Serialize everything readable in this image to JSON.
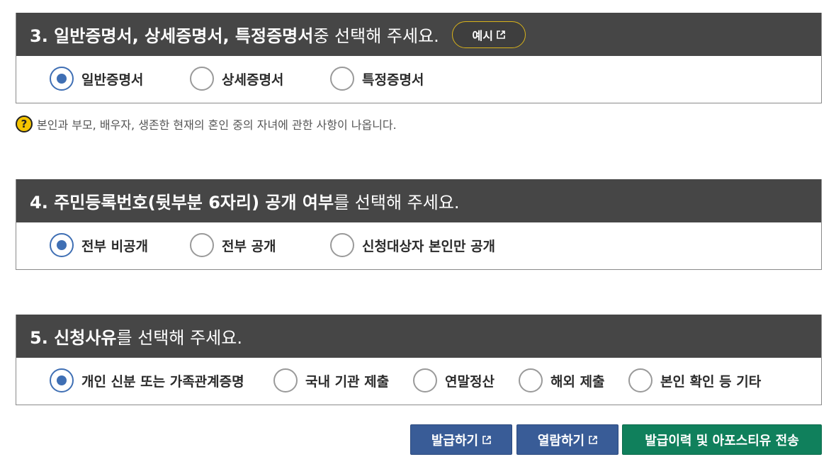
{
  "section3": {
    "title_bold": "3. 일반증명서, 상세증명서, 특정증명서",
    "title_rest": " 중 선택해 주세요.",
    "example_label": "예시",
    "options": [
      {
        "label": "일반증명서",
        "checked": true
      },
      {
        "label": "상세증명서",
        "checked": false
      },
      {
        "label": "특정증명서",
        "checked": false
      }
    ],
    "hint": "본인과 부모, 배우자, 생존한 현재의 혼인 중의 자녀에 관한 사항이 나옵니다.",
    "hint_icon": "?"
  },
  "section4": {
    "title_bold": "4. 주민등록번호(뒷부분 6자리) 공개 여부",
    "title_rest": "를 선택해 주세요.",
    "options": [
      {
        "label": "전부 비공개",
        "checked": true
      },
      {
        "label": "전부 공개",
        "checked": false
      },
      {
        "label": "신청대상자 본인만 공개",
        "checked": false
      }
    ]
  },
  "section5": {
    "title_bold": "5. 신청사유",
    "title_rest": "를 선택해 주세요.",
    "options": [
      {
        "label": "개인 신분 또는 가족관계증명",
        "checked": true
      },
      {
        "label": "국내 기관 제출",
        "checked": false
      },
      {
        "label": "연말정산",
        "checked": false
      },
      {
        "label": "해외 제출",
        "checked": false
      },
      {
        "label": "본인 확인 등 기타",
        "checked": false
      }
    ]
  },
  "buttons": {
    "issue": "발급하기",
    "view": "열람하기",
    "history": "발급이력 및 아포스티유 전송"
  },
  "colors": {
    "header_bg": "#464646",
    "radio_checked": "#3f6fb4",
    "btn_blue": "#395c97",
    "btn_green": "#10805c",
    "example_border": "#d8b21a"
  }
}
